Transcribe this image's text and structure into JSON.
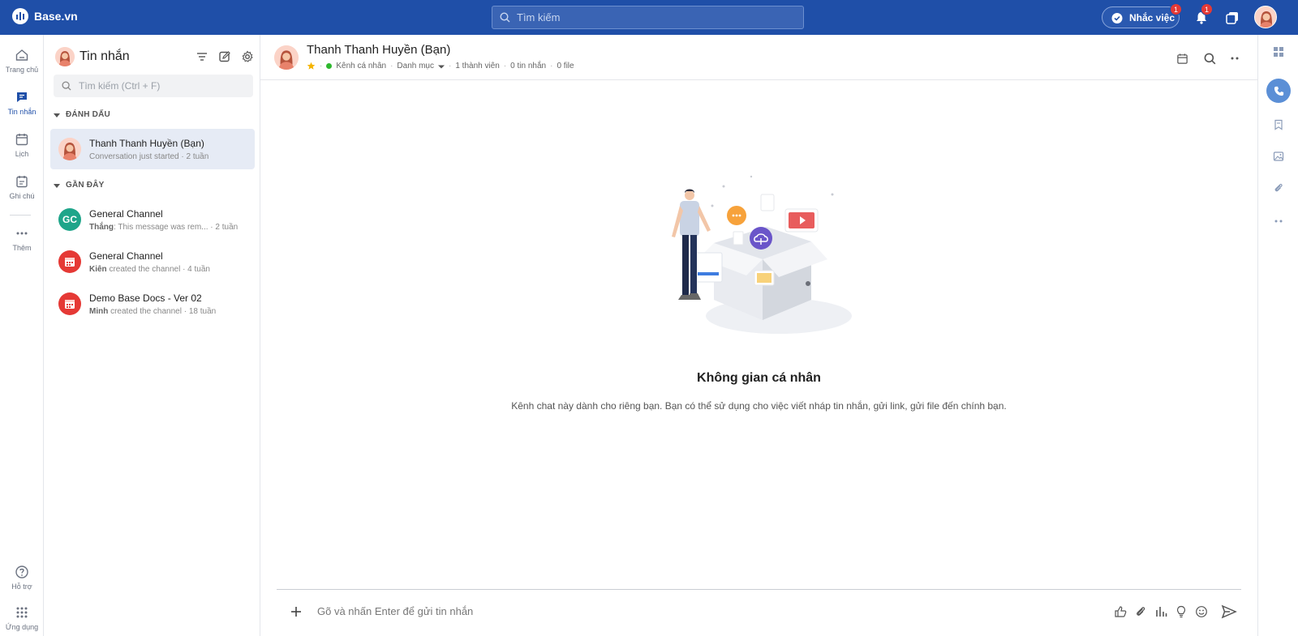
{
  "topbar": {
    "brand": "Base.vn",
    "search_placeholder": "Tìm kiếm",
    "reminder_label": "Nhắc việc",
    "reminder_badge": "1",
    "notification_badge": "1"
  },
  "rail": {
    "items": [
      {
        "label": "Trang chủ",
        "icon": "home-icon"
      },
      {
        "label": "Tin nhắn",
        "icon": "message-icon"
      },
      {
        "label": "Lịch",
        "icon": "calendar-icon"
      },
      {
        "label": "Ghi chú",
        "icon": "note-icon"
      },
      {
        "label": "Thêm",
        "icon": "more-icon"
      }
    ],
    "bottom": [
      {
        "label": "Hỗ trợ",
        "icon": "help-icon"
      },
      {
        "label": "Ứng dụng",
        "icon": "apps-icon"
      }
    ]
  },
  "list": {
    "title": "Tin nhắn",
    "search_placeholder": "Tìm kiếm (Ctrl + F)",
    "sections": {
      "starred": "ĐÁNH DẤU",
      "recent": "GẦN ĐÂY"
    },
    "starred_items": [
      {
        "name": "Thanh Thanh Huyền (Bạn)",
        "sub": "Conversation just started · 2 tuần"
      }
    ],
    "recent_items": [
      {
        "name": "General Channel",
        "initials": "GC",
        "color": "#1fa58a",
        "author": "Thắng",
        "text": ": This message was rem...",
        "time": " · 2 tuần"
      },
      {
        "name": "General Channel",
        "initials": "",
        "color": "#e53935",
        "author": "Kiên",
        "text": " created the channel",
        "time": " · 4 tuần"
      },
      {
        "name": "Demo Base Docs - Ver 02",
        "initials": "",
        "color": "#e53935",
        "author": "Minh",
        "text": " created the channel",
        "time": " · 18 tuần"
      }
    ]
  },
  "main": {
    "title": "Thanh Thanh Huyền (Bạn)",
    "meta": {
      "channel_type": "Kênh cá nhân",
      "category": "Danh mục",
      "members": "1 thành viên",
      "messages": "0 tin nhắn",
      "files": "0 file"
    },
    "empty_title": "Không gian cá nhân",
    "empty_desc": "Kênh chat này dành cho riêng bạn. Bạn có thể sử dụng cho việc viết nháp tin nhắn, gửi link, gửi file đến chính bạn.",
    "composer_placeholder": "Gõ và nhấn Enter để gửi tin nhắn"
  },
  "colors": {
    "brand_blue": "#1f4fa8",
    "accent_red": "#e53935",
    "online_green": "#2eb82e",
    "star_yellow": "#f5b400"
  }
}
